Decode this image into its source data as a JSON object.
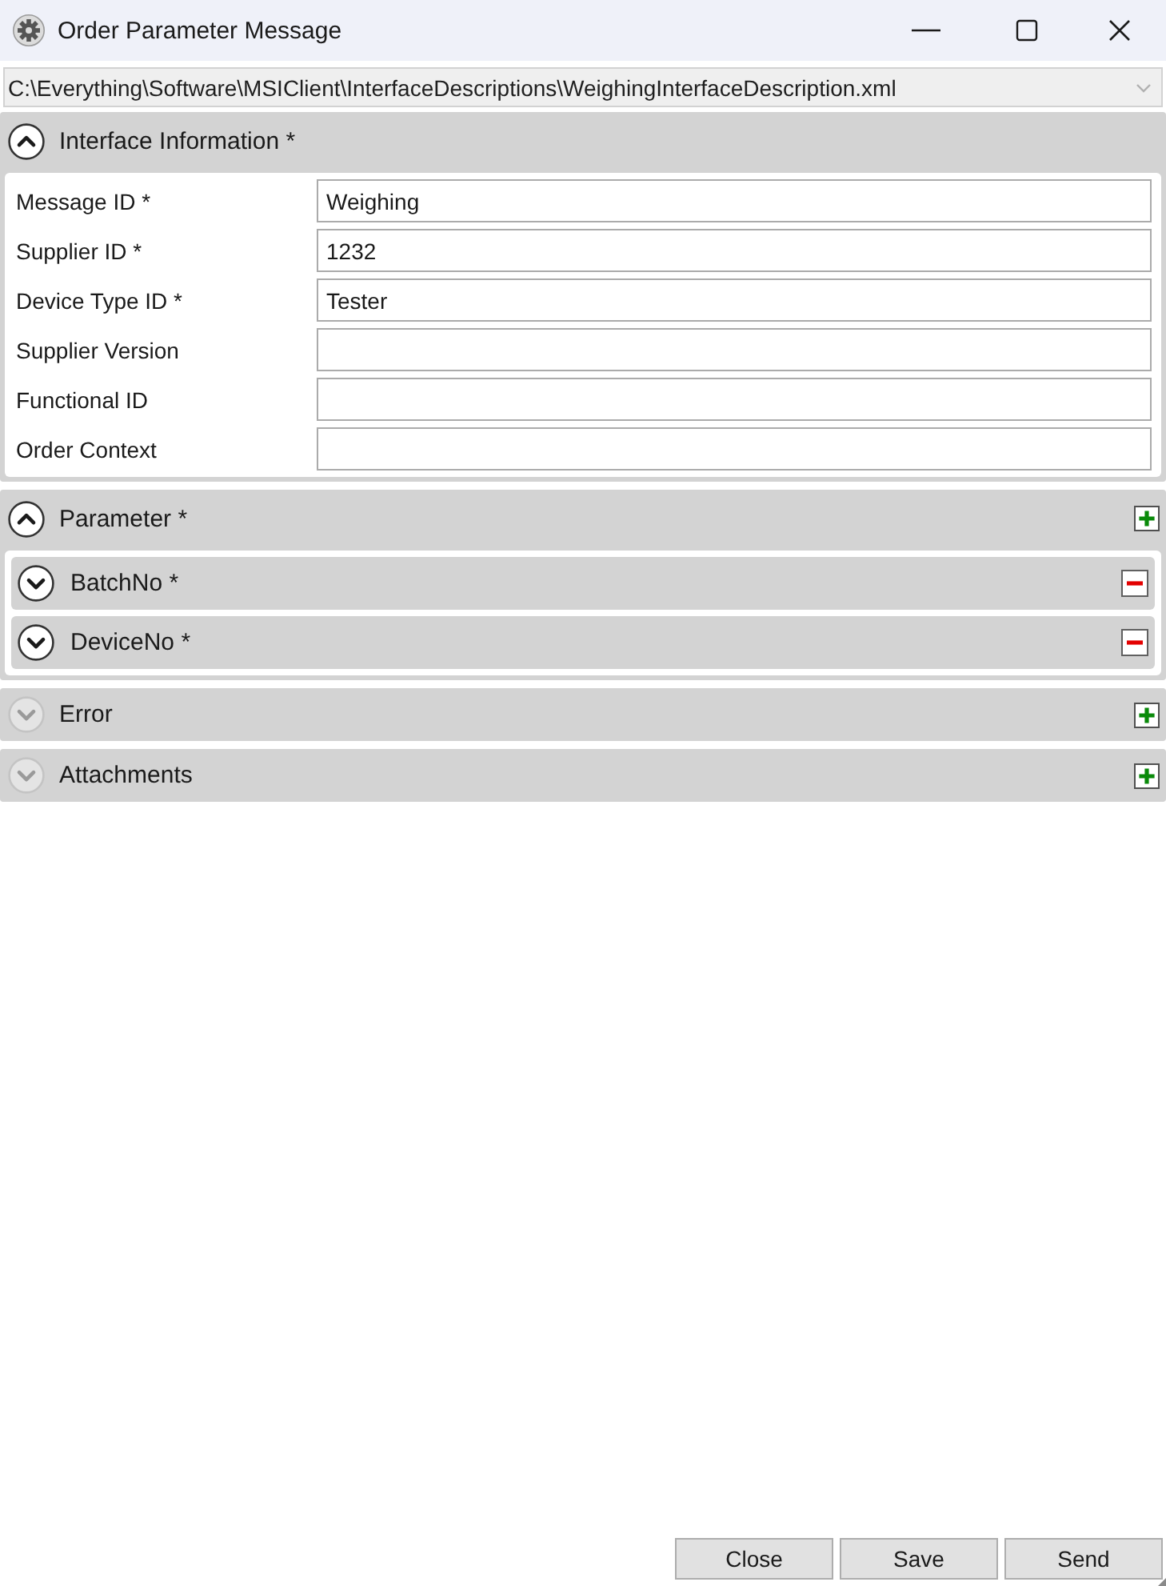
{
  "window": {
    "title": "Order Parameter Message"
  },
  "file_path": {
    "value": "C:\\Everything\\Software\\MSIClient\\InterfaceDescriptions\\WeighingInterfaceDescription.xml"
  },
  "sections": [
    {
      "title": "Interface Information *",
      "expanded": true,
      "disabled": false,
      "can_add": false,
      "fields": [
        {
          "label": "Message ID *",
          "value": "Weighing"
        },
        {
          "label": "Supplier ID *",
          "value": "1232"
        },
        {
          "label": "Device Type ID *",
          "value": "Tester"
        },
        {
          "label": "Supplier Version"
        },
        {
          "label": "Functional ID"
        },
        {
          "label": "Order Context"
        }
      ]
    },
    {
      "title": "Parameter *",
      "expanded": true,
      "disabled": false,
      "can_add": true,
      "items": [
        {
          "title": "BatchNo *",
          "expanded": false,
          "can_remove": true
        },
        {
          "title": "DeviceNo *",
          "expanded": false,
          "can_remove": true
        }
      ]
    },
    {
      "title": "Error",
      "expanded": false,
      "disabled": true,
      "can_add": true
    },
    {
      "title": "Attachments",
      "expanded": false,
      "disabled": true,
      "can_add": true
    }
  ],
  "buttons": [
    {
      "label": "Close"
    },
    {
      "label": "Save"
    },
    {
      "label": "Send"
    }
  ]
}
